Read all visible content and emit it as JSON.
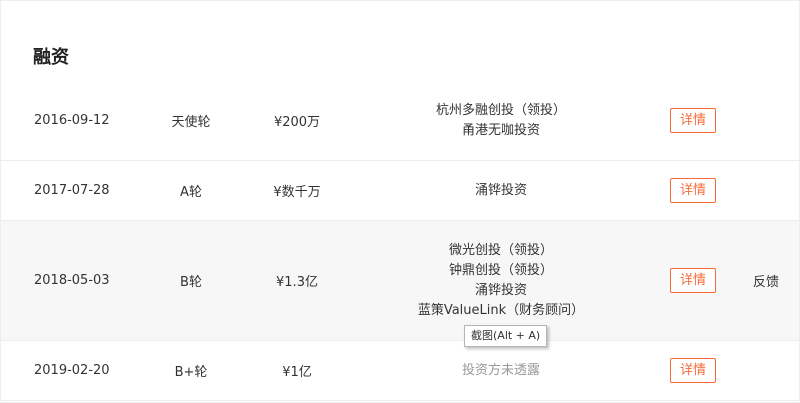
{
  "section": {
    "title": "融资"
  },
  "rows": [
    {
      "date": "2016-09-12",
      "round": "天使轮",
      "amount": "¥200万",
      "investors": [
        "杭州多融创投（领投）",
        "甬港无咖投资"
      ],
      "detail_label": "详情"
    },
    {
      "date": "2017-07-28",
      "round": "A轮",
      "amount": "¥数千万",
      "investors": [
        "涌铧投资"
      ],
      "detail_label": "详情"
    },
    {
      "date": "2018-05-03",
      "round": "B轮",
      "amount": "¥1.3亿",
      "investors": [
        "微光创投（领投）",
        "钟鼎创投（领投）",
        "涌铧投资",
        "蓝策ValueLink（财务顾问）"
      ],
      "detail_label": "详情",
      "feedback_label": "反馈"
    },
    {
      "date": "2019-02-20",
      "round": "B+轮",
      "amount": "¥1亿",
      "investors_muted": "投资方未透露",
      "detail_label": "详情"
    }
  ],
  "tooltip": {
    "text": "截图(Alt + A)"
  },
  "colors": {
    "accent": "#f56b3a",
    "hover_row": "#f7f7f7",
    "muted": "#999999"
  }
}
